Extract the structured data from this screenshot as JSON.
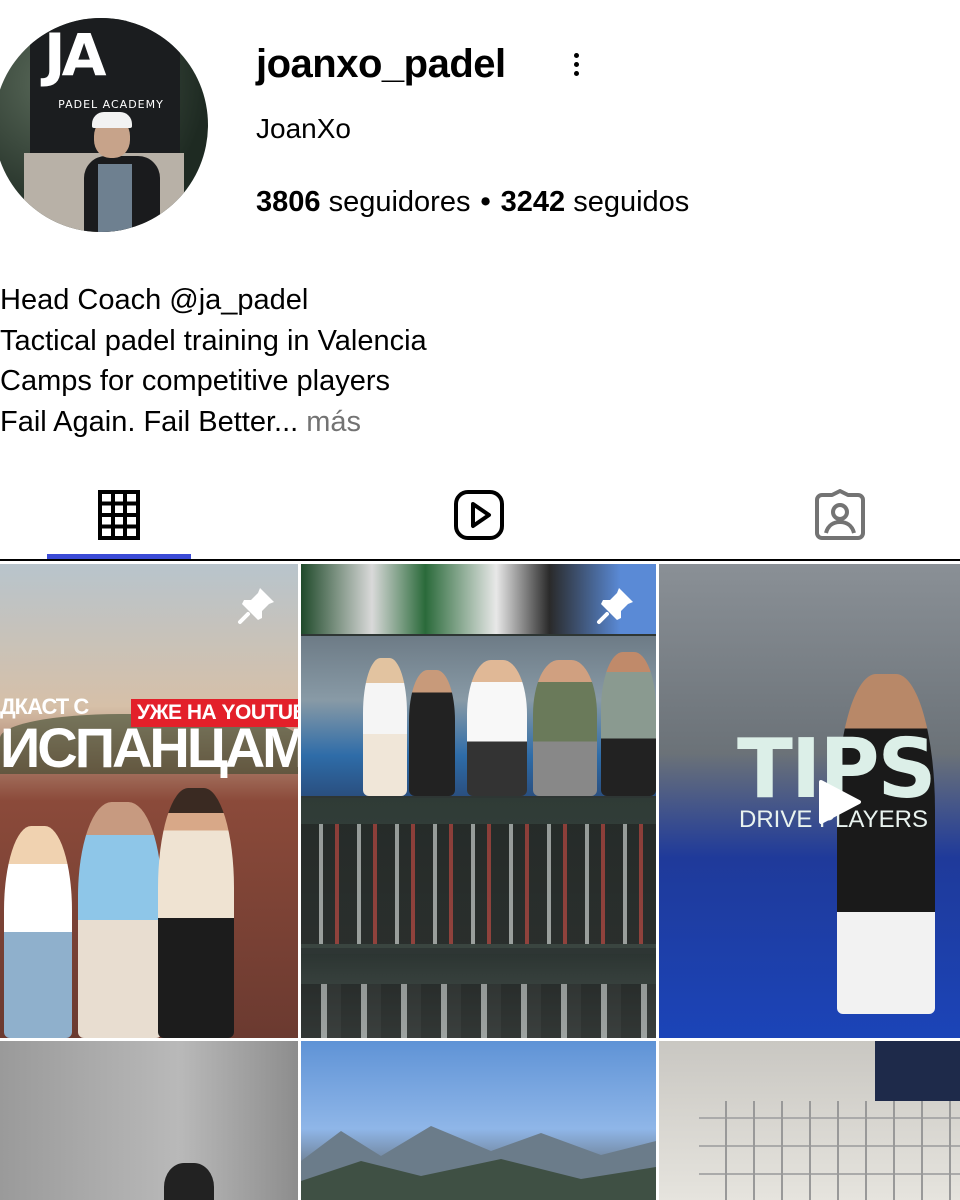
{
  "profile": {
    "username": "joanxo_padel",
    "display_name": "JoanXo",
    "followers_count": "3806",
    "followers_label": "seguidores",
    "separator": "•",
    "following_count": "3242",
    "following_label": "seguidos",
    "avatar": {
      "banner_logo": "JA",
      "banner_text": "PADEL ACADEMY"
    }
  },
  "bio": {
    "lines": [
      "Head Coach @ja_padel",
      "Tactical padel training in Valencia",
      "Camps for competitive players",
      "Fail Again. Fail Better..."
    ],
    "more_label": "más"
  },
  "tabs": [
    {
      "icon": "grid-icon",
      "active": true
    },
    {
      "icon": "reels-icon",
      "active": false
    },
    {
      "icon": "tagged-icon",
      "active": false
    }
  ],
  "posts": [
    {
      "pinned": true,
      "overlay_texts": [
        "ДКАСТ С",
        "ИСПАНЦАМИ",
        "УЖЕ НА YOUTUBE"
      ]
    },
    {
      "pinned": true,
      "overlay_texts": []
    },
    {
      "pinned": false,
      "is_reel": true,
      "overlay_texts": [
        "TIPS",
        "DRIVE PLAYERS"
      ]
    },
    {
      "pinned": false,
      "overlay_texts": []
    },
    {
      "pinned": false,
      "overlay_texts": []
    },
    {
      "pinned": false,
      "overlay_texts": []
    }
  ],
  "colors": {
    "active_tab_indicator": "#3b4bd6",
    "more_link": "#737373",
    "youtube_badge": "#e3202a"
  }
}
